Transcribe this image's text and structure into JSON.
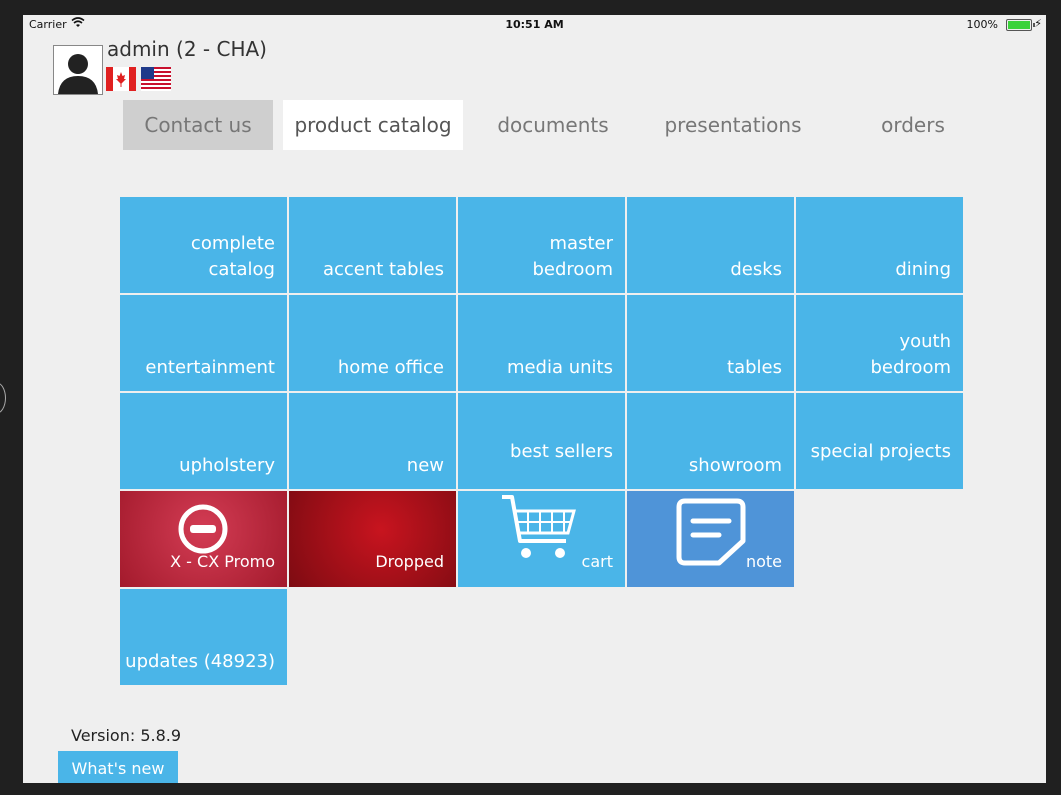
{
  "status_bar": {
    "carrier": "Carrier",
    "time": "10:51 AM",
    "battery": "100%",
    "wifi_icon": "wifi-icon",
    "battery_icon": "battery-icon"
  },
  "user": {
    "name": "admin (2 - CHA)",
    "flags": [
      "canada-flag-icon",
      "usa-flag-icon"
    ]
  },
  "tabs": [
    {
      "label": "Contact us"
    },
    {
      "label": "product catalog"
    },
    {
      "label": "documents"
    },
    {
      "label": "presentations"
    },
    {
      "label": "orders"
    }
  ],
  "tiles": [
    {
      "label": "complete\ncatalog"
    },
    {
      "label": "accent tables"
    },
    {
      "label": "master\nbedroom"
    },
    {
      "label": "desks"
    },
    {
      "label": "dining"
    },
    {
      "label": "entertainment"
    },
    {
      "label": "home office"
    },
    {
      "label": "media units"
    },
    {
      "label": "tables"
    },
    {
      "label": "youth\nbedroom"
    },
    {
      "label": "upholstery"
    },
    {
      "label": "new"
    },
    {
      "label": "best sellers"
    },
    {
      "label": "showroom"
    },
    {
      "label": "special projects"
    },
    {
      "label": "X - CX Promo",
      "icon": "minus-circle-icon"
    },
    {
      "label": "Dropped"
    },
    {
      "label": "cart",
      "icon": "cart-icon"
    },
    {
      "label": "note",
      "icon": "note-icon"
    },
    {
      "label": "updates (48923)"
    }
  ],
  "footer": {
    "version": "Version: 5.8.9",
    "whats_new": "What's new"
  }
}
